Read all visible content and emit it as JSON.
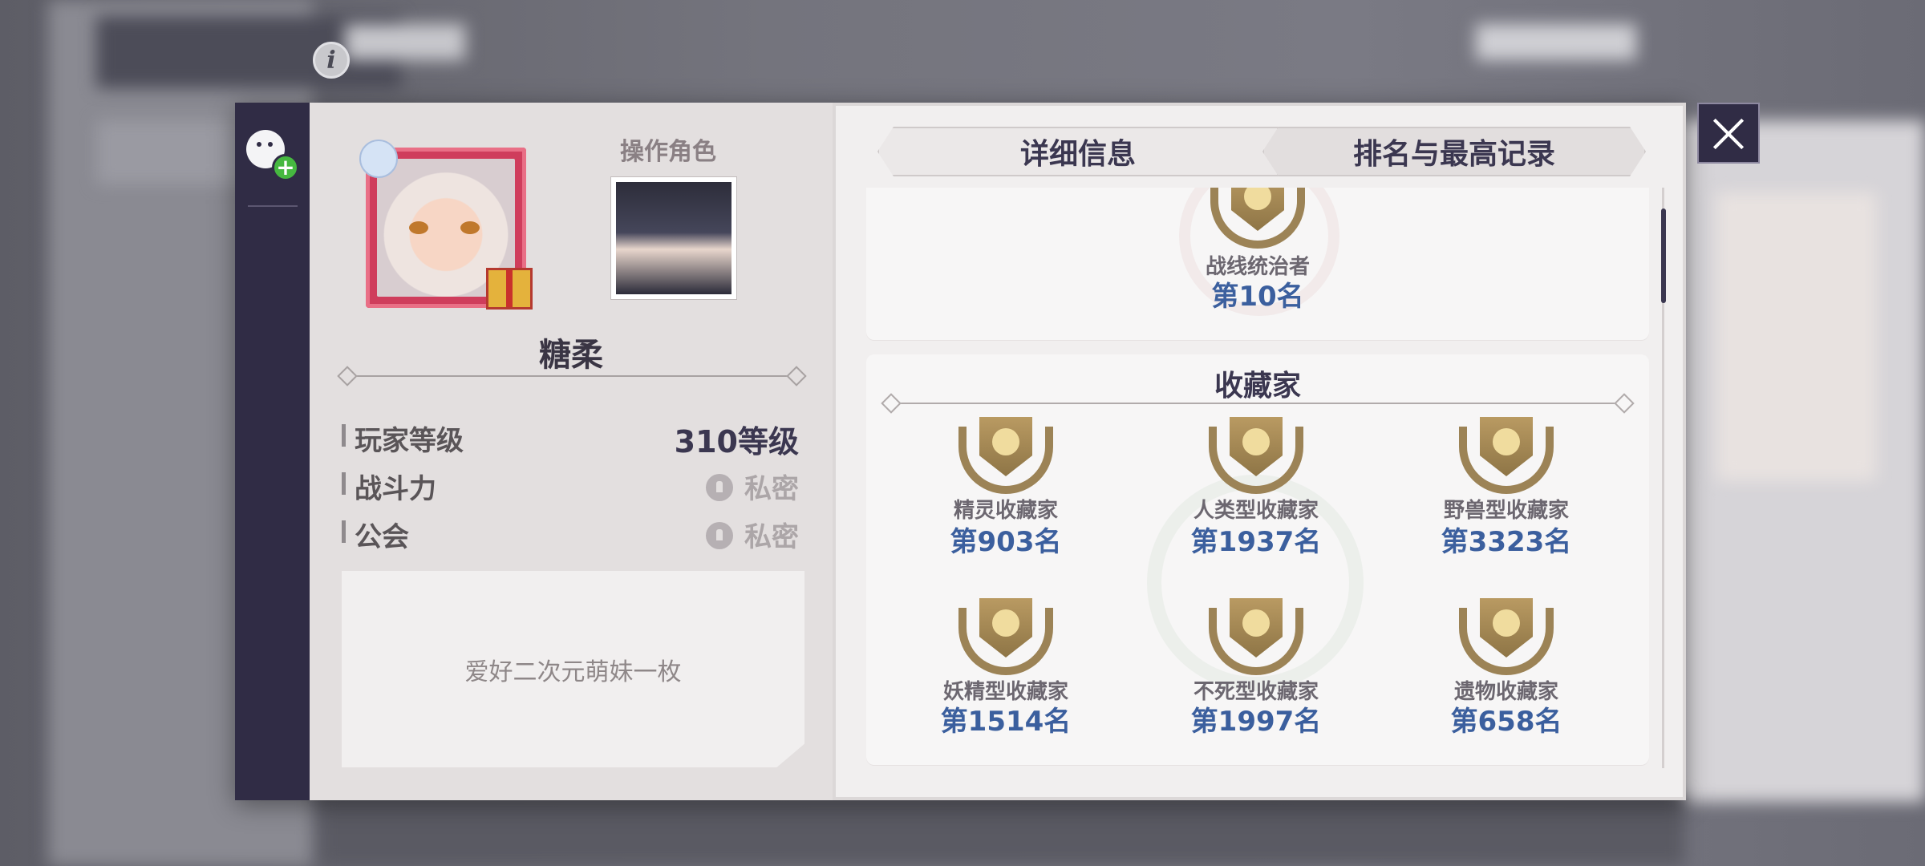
{
  "header": {
    "info_icon_glyph": "i"
  },
  "sidebar": {
    "friend_add_icon": "add-friend-icon"
  },
  "profile": {
    "operator_label": "操作角色",
    "player_name": "糖柔",
    "stats": [
      {
        "label": "玩家等级",
        "value": "310等级",
        "private": false
      },
      {
        "label": "战斗力",
        "value": "私密",
        "private": true
      },
      {
        "label": "公会",
        "value": "私密",
        "private": true
      }
    ],
    "bio": "爱好二次元萌妹一枚"
  },
  "tabs": [
    {
      "label": "详细信息",
      "active": false
    },
    {
      "label": "排名与最高记录",
      "active": true
    }
  ],
  "top_badge": {
    "title": "战线统治者",
    "rank": "第10名"
  },
  "collector_section": {
    "title": "收藏家",
    "badges": [
      {
        "title": "精灵收藏家",
        "rank": "第903名"
      },
      {
        "title": "人类型收藏家",
        "rank": "第1937名"
      },
      {
        "title": "野兽型收藏家",
        "rank": "第3323名"
      },
      {
        "title": "妖精型收藏家",
        "rank": "第1514名"
      },
      {
        "title": "不死型收藏家",
        "rank": "第1997名"
      },
      {
        "title": "遗物收藏家",
        "rank": "第658名"
      }
    ]
  },
  "colors": {
    "sidebar": "#302c45",
    "rank_blue": "#3b5f9e",
    "badge_bronze": "#9c8356"
  }
}
